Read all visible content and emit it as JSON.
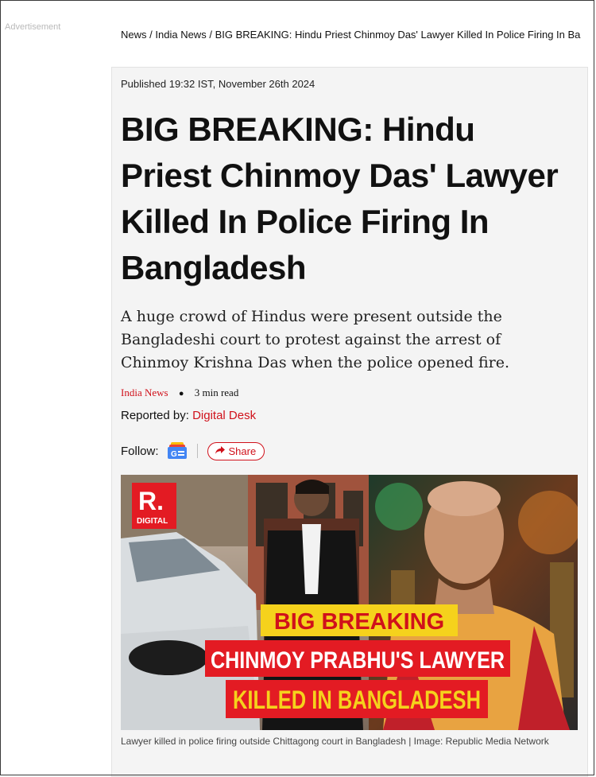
{
  "sidebar": {
    "ad_label": "Advertisement"
  },
  "breadcrumb": {
    "items": [
      "News",
      "India News",
      "BIG BREAKING: Hindu Priest Chinmoy Das' Lawyer Killed In Police Firing In Ba"
    ],
    "separator": "/"
  },
  "article": {
    "published": "Published 19:32 IST, November 26th 2024",
    "headline": "BIG BREAKING: Hindu Priest Chinmoy Das' Lawyer Killed In Police Firing In Bangladesh",
    "subhead": "A huge crowd of Hindus were present outside the Bangladeshi court to protest against the arrest of Chinmoy Krishna Das when the police opened fire.",
    "category": "India News",
    "read_time": "3 min read",
    "reported_label": "Reported by:",
    "author": "Digital Desk",
    "follow_label": "Follow:",
    "share_label": "Share",
    "image": {
      "logo_letter": "R.",
      "logo_text": "DIGITAL",
      "overlay_line1": "BIG BREAKING",
      "overlay_line2": "CHINMOY PRABHU'S LAWYER",
      "overlay_line3": "KILLED IN BANGLADESH"
    },
    "caption": "Lawyer killed in police firing outside Chittagong court in Bangladesh | Image: Republic Media Network"
  },
  "colors": {
    "accent_red": "#d0111b",
    "overlay_yellow": "#f5d21c",
    "card_bg": "#f4f4f4"
  },
  "icons": [
    "google-news-icon",
    "share-arrow-icon"
  ]
}
